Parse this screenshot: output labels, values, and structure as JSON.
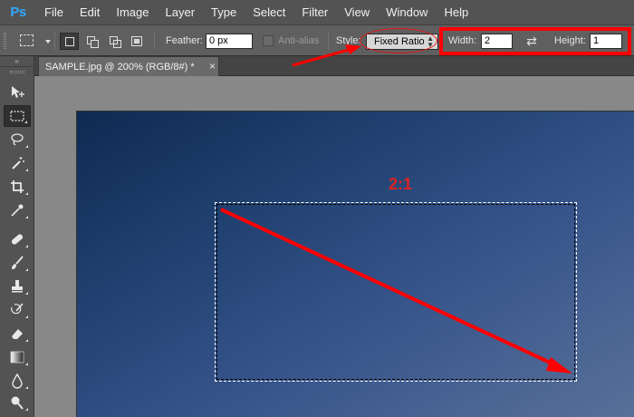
{
  "app": {
    "logo": "Ps"
  },
  "menu": [
    "File",
    "Edit",
    "Image",
    "Layer",
    "Type",
    "Select",
    "Filter",
    "View",
    "Window",
    "Help"
  ],
  "options": {
    "feather_label": "Feather:",
    "feather_value": "0 px",
    "antialias_label": "Anti-alias",
    "style_label": "Style:",
    "style_value": "Fixed Ratio",
    "width_label": "Width:",
    "width_value": "2",
    "height_label": "Height:",
    "height_value": "1"
  },
  "tools_panel": {
    "collapse_glyph": "»"
  },
  "document": {
    "tab_title": "SAMPLE.jpg @ 200% (RGB/8#) *",
    "close_glyph": "×"
  },
  "annotations": {
    "ratio_label": "2:1",
    "highlight_color": "#ff0000"
  },
  "icons": {
    "tools": [
      "move-icon",
      "rectangular-marquee-icon",
      "lasso-icon",
      "magic-wand-icon",
      "crop-icon",
      "eyedropper-icon",
      "spot-healing-icon",
      "brush-icon",
      "clone-stamp-icon",
      "history-brush-icon",
      "eraser-icon",
      "gradient-icon",
      "blur-icon",
      "dodge-icon"
    ],
    "swap": "swap-arrows-icon"
  }
}
